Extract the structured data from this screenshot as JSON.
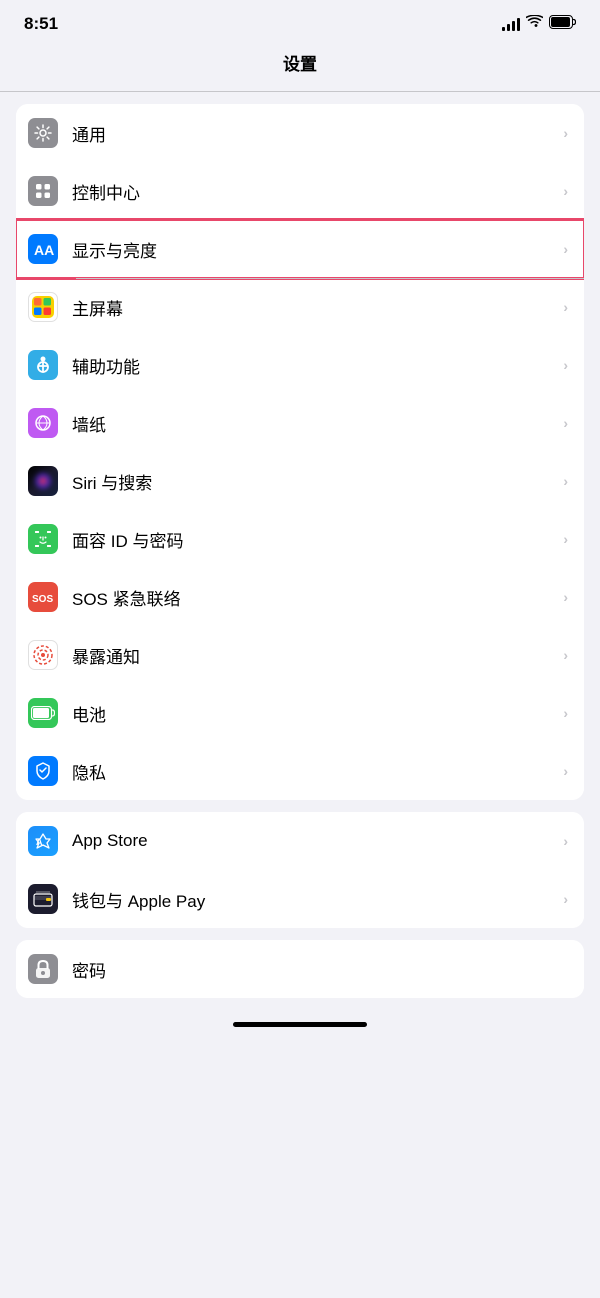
{
  "statusBar": {
    "time": "8:51",
    "signal": "signal-icon",
    "wifi": "wifi-icon",
    "battery": "battery-icon"
  },
  "pageTitle": "设置",
  "sections": [
    {
      "id": "section1",
      "rows": [
        {
          "id": "general",
          "label": "通用",
          "iconType": "gear",
          "iconBg": "gray",
          "highlighted": false
        },
        {
          "id": "control-center",
          "label": "控制中心",
          "iconType": "toggle",
          "iconBg": "gray",
          "highlighted": false
        },
        {
          "id": "display",
          "label": "显示与亮度",
          "iconType": "aa",
          "iconBg": "blue",
          "highlighted": true
        },
        {
          "id": "homescreen",
          "label": "主屏幕",
          "iconType": "homescreen",
          "iconBg": "multicolor",
          "highlighted": false
        },
        {
          "id": "accessibility",
          "label": "辅助功能",
          "iconType": "accessibility",
          "iconBg": "teal",
          "highlighted": false
        },
        {
          "id": "wallpaper",
          "label": "墙纸",
          "iconType": "flower",
          "iconBg": "purple",
          "highlighted": false
        },
        {
          "id": "siri",
          "label": "Siri 与搜索",
          "iconType": "siri",
          "iconBg": "siri",
          "highlighted": false
        },
        {
          "id": "faceid",
          "label": "面容 ID 与密码",
          "iconType": "faceid",
          "iconBg": "green-face",
          "highlighted": false
        },
        {
          "id": "sos",
          "label": "SOS 紧急联络",
          "iconType": "sos",
          "iconBg": "red",
          "highlighted": false
        },
        {
          "id": "exposure",
          "label": "暴露通知",
          "iconType": "exposure",
          "iconBg": "red-dot",
          "highlighted": false
        },
        {
          "id": "battery",
          "label": "电池",
          "iconType": "battery",
          "iconBg": "green-battery",
          "highlighted": false
        },
        {
          "id": "privacy",
          "label": "隐私",
          "iconType": "hand",
          "iconBg": "blue-hand",
          "highlighted": false
        }
      ]
    },
    {
      "id": "section2",
      "rows": [
        {
          "id": "appstore",
          "label": "App Store",
          "iconType": "appstore",
          "iconBg": "app-store",
          "highlighted": false
        },
        {
          "id": "wallet",
          "label": "钱包与 Apple Pay",
          "iconType": "wallet",
          "iconBg": "wallet",
          "highlighted": false
        }
      ]
    },
    {
      "id": "section3",
      "rows": [
        {
          "id": "password",
          "label": "密码",
          "iconType": "password",
          "iconBg": "password",
          "highlighted": false
        }
      ]
    }
  ]
}
